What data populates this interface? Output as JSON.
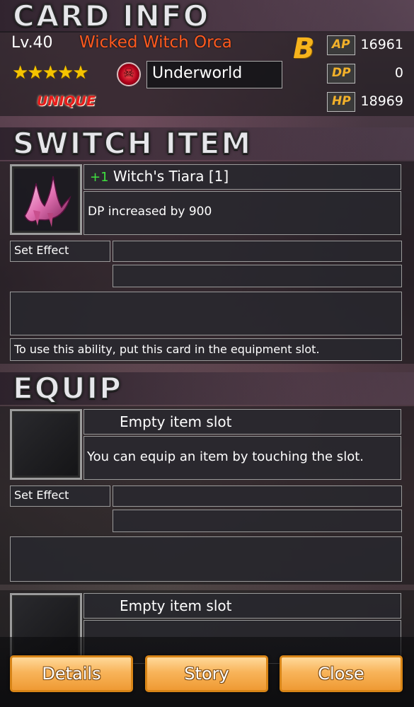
{
  "card_info": {
    "heading": "CARD INFO",
    "level": "Lv.40",
    "name": "Wicked Witch Orca",
    "stars": "★★★★★",
    "rarity": "UNIQUE",
    "element_icon": "skull-emblem-icon",
    "element": "Underworld",
    "grade": "B",
    "stats": [
      {
        "label": "AP",
        "value": "16961"
      },
      {
        "label": "DP",
        "value": "0"
      },
      {
        "label": "HP",
        "value": "18969"
      }
    ],
    "colors": {
      "name": "#ff5a1f",
      "grade": "#f6b31c",
      "rarity": "#e81a1a",
      "stat_label": "#f2b12a"
    }
  },
  "switch_item": {
    "heading": "SWITCH ITEM",
    "item_icon": "witch-tiara-icon",
    "plus": "+1",
    "item_name": "Witch's Tiara [1]",
    "description": "DP increased by 900",
    "set_effect_label": "Set Effect",
    "note": "To use this ability, put this card in the equipment slot."
  },
  "equip": {
    "heading": "EQUIP",
    "slots": [
      {
        "title": "Empty item slot",
        "description": "You can equip an item by touching the slot.",
        "set_effect_label": "Set Effect"
      },
      {
        "title": "Empty item slot"
      }
    ]
  },
  "buttons": {
    "details": "Details",
    "story": "Story",
    "close": "Close"
  }
}
